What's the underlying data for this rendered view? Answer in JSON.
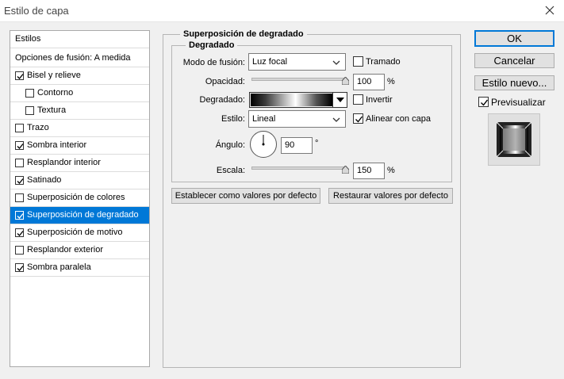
{
  "window": {
    "title": "Estilo de capa"
  },
  "styles_list": {
    "header": "Estilos",
    "blend_options": "Opciones de fusión: A medida",
    "items": [
      {
        "label": "Bisel y relieve",
        "checked": true,
        "level": 0
      },
      {
        "label": "Contorno",
        "checked": false,
        "level": 1
      },
      {
        "label": "Textura",
        "checked": false,
        "level": 1
      },
      {
        "label": "Trazo",
        "checked": false,
        "level": 0
      },
      {
        "label": "Sombra interior",
        "checked": true,
        "level": 0
      },
      {
        "label": "Resplandor interior",
        "checked": false,
        "level": 0
      },
      {
        "label": "Satinado",
        "checked": true,
        "level": 0
      },
      {
        "label": "Superposición de colores",
        "checked": false,
        "level": 0
      },
      {
        "label": "Superposición de degradado",
        "checked": true,
        "level": 0,
        "selected": true
      },
      {
        "label": "Superposición de motivo",
        "checked": true,
        "level": 0
      },
      {
        "label": "Resplandor exterior",
        "checked": false,
        "level": 0
      },
      {
        "label": "Sombra paralela",
        "checked": true,
        "level": 0
      }
    ]
  },
  "panel": {
    "title": "Superposición de degradado",
    "subtitle": "Degradado",
    "blend_mode_label": "Modo de fusión:",
    "blend_mode_value": "Luz focal",
    "dither_label": "Tramado",
    "dither_checked": false,
    "opacity_label": "Opacidad:",
    "opacity_value": "100",
    "opacity_percent": 100,
    "gradient_label": "Degradado:",
    "reverse_label": "Invertir",
    "reverse_checked": false,
    "style_label": "Estilo:",
    "style_value": "Lineal",
    "align_label": "Alinear con capa",
    "align_checked": true,
    "angle_label": "Ángulo:",
    "angle_value": "90",
    "angle_unit": "°",
    "scale_label": "Escala:",
    "scale_value": "150",
    "scale_percent": 150,
    "percent_unit": "%",
    "set_default_button": "Establecer como valores por defecto",
    "reset_default_button": "Restaurar valores por defecto"
  },
  "actions": {
    "ok": "OK",
    "cancel": "Cancelar",
    "new_style": "Estilo nuevo...",
    "preview_label": "Previsualizar",
    "preview_checked": true
  },
  "colors": {
    "selection": "#0078d7",
    "background": "#f0f0f0"
  }
}
